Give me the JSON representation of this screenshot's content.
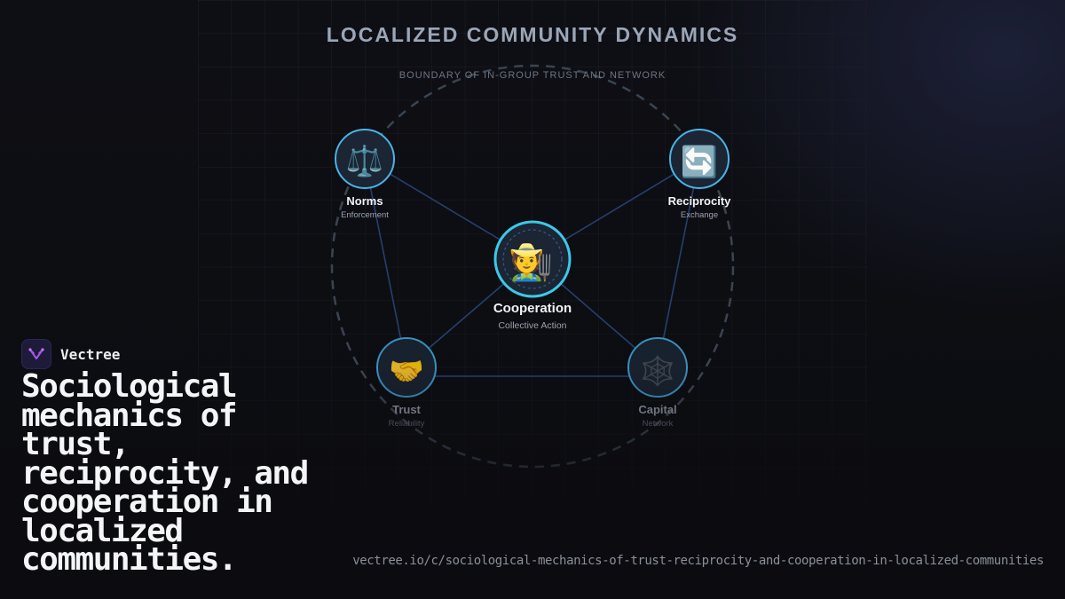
{
  "header": {
    "title": "LOCALIZED COMMUNITY DYNAMICS",
    "boundary_label": "BOUNDARY OF IN-GROUP TRUST AND NETWORK"
  },
  "diagram": {
    "center": {
      "name": "Cooperation",
      "sub": "Collective Action",
      "icon": "farmer-icon",
      "glyph": "🧑‍🌾"
    },
    "nodes": [
      {
        "id": "norms",
        "name": "Norms",
        "sub": "Enforcement",
        "icon": "scales-icon",
        "glyph": "⚖️"
      },
      {
        "id": "reciprocity",
        "name": "Reciprocity",
        "sub": "Exchange",
        "icon": "cycle-icon",
        "glyph": "🔄"
      },
      {
        "id": "trust",
        "name": "Trust",
        "sub": "Reliability",
        "icon": "handshake-icon",
        "glyph": "🤝"
      },
      {
        "id": "capital",
        "name": "Capital",
        "sub": "Network",
        "icon": "web-icon",
        "glyph": "🕸️"
      }
    ],
    "colors": {
      "accent": "#3cc8e8",
      "node_ring": "#4ab4e6",
      "edge": "#25406e",
      "boundary": "#3a4452"
    }
  },
  "brand": {
    "name": "Vectree",
    "icon": "vectree-logo-icon",
    "accent": "#a657e8"
  },
  "headline": "Sociological mechanics of trust, reciprocity, and cooperation in localized communities.",
  "footer": {
    "url": "vectree.io/c/sociological-mechanics-of-trust-reciprocity-and-cooperation-in-localized-communities"
  }
}
